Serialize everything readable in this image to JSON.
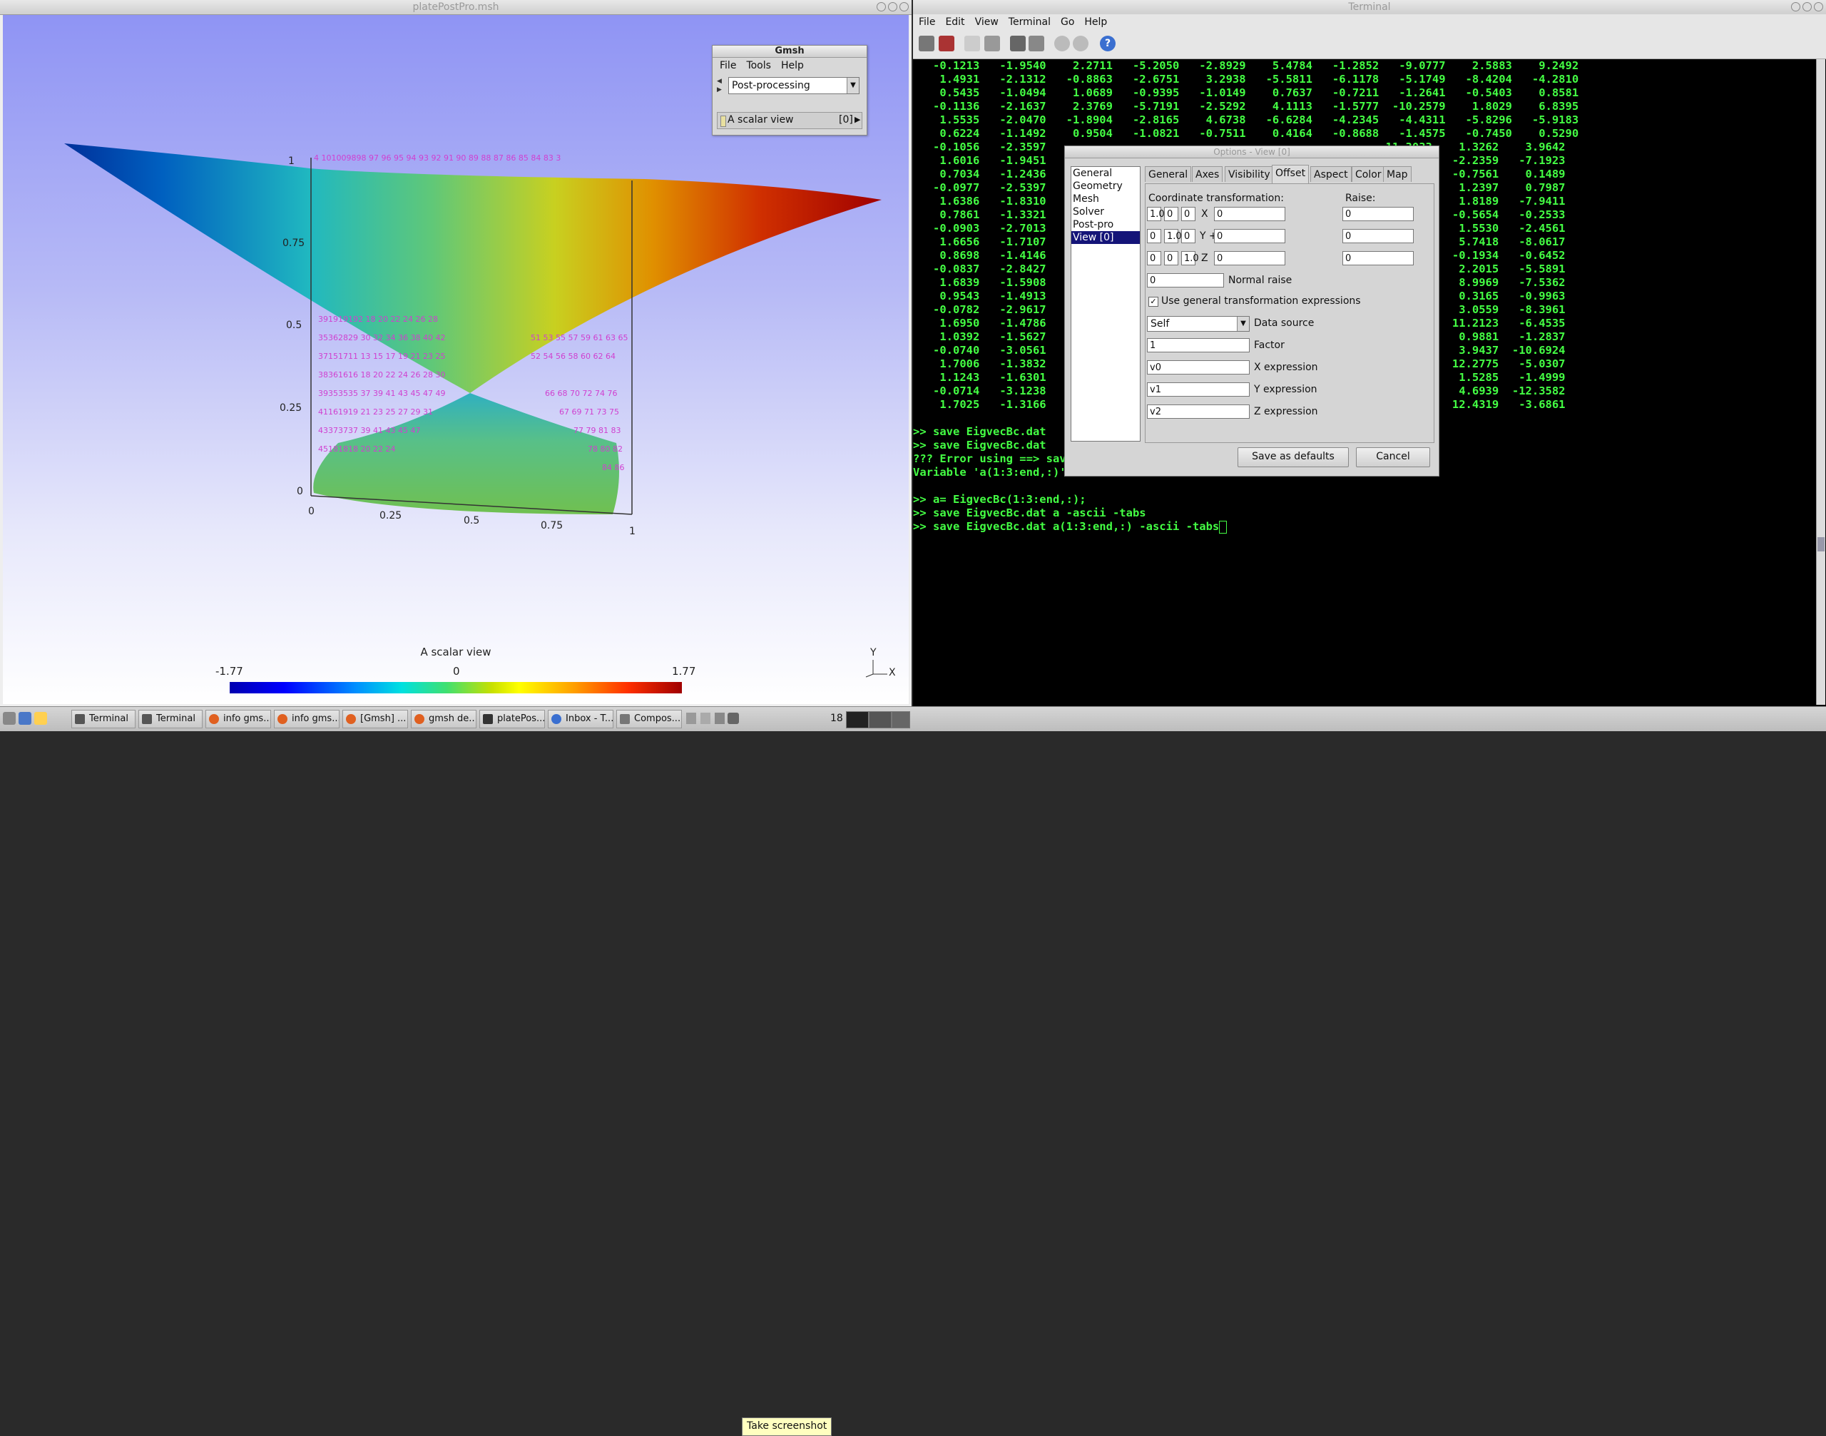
{
  "gmsh": {
    "window_title": "platePostPro.msh",
    "small_title": "Gmsh",
    "menu": [
      "File",
      "Tools",
      "Help"
    ],
    "module": "Post-processing",
    "view_label": "A scalar view",
    "view_index": "[0]",
    "colorbar": {
      "title": "A scalar view",
      "min": "-1.77",
      "mid": "0",
      "max": "1.77"
    },
    "axis_y_ticks": [
      "1",
      "0.75",
      "0.5",
      "0.25",
      "0"
    ],
    "axis_x_ticks": [
      "0",
      "0.25",
      "0.5",
      "0.75",
      "1"
    ],
    "axes_triad": {
      "y": "Y",
      "x": "X"
    }
  },
  "terminal": {
    "window_title": "Terminal",
    "menu": [
      "File",
      "Edit",
      "View",
      "Terminal",
      "Go",
      "Help"
    ],
    "lines": [
      "   -0.1213   -1.9540    2.2711   -5.2050   -2.8929    5.4784   -1.2852   -9.0777    2.5883    9.2492",
      "    1.4931   -2.1312   -0.8863   -2.6751    3.2938   -5.5811   -6.1178   -5.1749   -8.4204   -4.2810",
      "    0.5435   -1.0494    1.0689   -0.9395   -1.0149    0.7637   -0.7211   -1.2641   -0.5403    0.8581",
      "   -0.1136   -2.1637    2.3769   -5.7191   -2.5292    4.1113   -1.5777  -10.2579    1.8029    6.8395",
      "    1.5535   -2.0470   -1.8904   -2.8165    4.6738   -6.6284   -4.2345   -4.4311   -5.8296   -5.9183",
      "    0.6224   -1.1492    0.9504   -1.0821   -0.7511    0.4164   -0.8688   -1.4575   -0.7450    0.5290",
      "   -0.1056   -2.3597                                                   11.3033    1.3262    3.9642",
      "    1.6016   -1.9451                                                   -3.2497   -2.2359   -7.1923",
      "    0.7034   -1.2436                                                   -1.5836   -0.7561    0.1489",
      "   -0.0977   -2.5397                                                   12.1717    1.2397    0.7987",
      "    1.6386   -1.8310                                                    1.7663    1.8189   -7.9411",
      "    0.7861   -1.3321                                                   -1.6316   -0.5654   -0.2533",
      "   -0.0903   -2.7013                                                   12.8420    1.5530   -2.4561",
      "    1.6656   -1.7107                                                   -0.1509    5.7418   -8.0617",
      "    0.8698   -1.4146                                                   -1.5993   -0.1934   -0.6452",
      "   -0.0837   -2.8427                                                   13.3175    2.2015   -5.5891",
      "    1.6839   -1.5908                                                    1.4187    8.9969   -7.5362",
      "    0.9543   -1.4913                                                   -1.4930    0.3165   -0.9963",
      "   -0.0782   -2.9617                                                   13.6250    3.0559   -8.3961",
      "    1.6950   -1.4786                                                    2.7842   11.2123   -6.4535",
      "    1.0392   -1.5627                                                   -1.3261    0.9881   -1.2837",
      "   -0.0740   -3.0561                                                   13.8087    3.9437  -10.6924",
      "    1.7006   -1.3832                                                    3.8315   12.2775   -5.0307",
      "    1.1243   -1.6301                                                   -1.1164    1.5285   -1.4999",
      "   -0.0714   -3.1238                                                   13.9301    4.6939  -12.3582",
      "    1.7025   -1.3166                                                    4.4909   12.4319   -3.6861",
      "",
      ">> save EigvecBc.dat",
      ">> save EigvecBc.dat",
      "??? Error using ==> save",
      "Variable 'a(1:3:end,:)' not found.",
      "",
      ">> a= EigvecBc(1:3:end,:);",
      ">> save EigvecBc.dat a -ascii -tabs",
      ">> save EigvecBc.dat a(1:3:end,:) -ascii -tabs"
    ]
  },
  "options": {
    "title": "Options - View [0]",
    "categories": [
      "General",
      "Geometry",
      "Mesh",
      "Solver",
      "Post-pro",
      "View [0]"
    ],
    "tabs": [
      "General",
      "Axes",
      "Visibility",
      "Offset",
      "Aspect",
      "Color",
      "Map"
    ],
    "coord_label": "Coordinate transformation:",
    "raise_label": "Raise:",
    "matrix": [
      [
        "1.0",
        "0",
        "0"
      ],
      [
        "0",
        "1.0",
        "0"
      ],
      [
        "0",
        "0",
        "1.0"
      ]
    ],
    "axis_labels": [
      "X",
      "Y +",
      "Z"
    ],
    "offsets": [
      "0",
      "0",
      "0"
    ],
    "raises": [
      "0",
      "0",
      "0"
    ],
    "normal_raise_value": "0",
    "normal_raise_label": "Normal raise",
    "use_general_label": "Use general transformation expressions",
    "data_source_value": "Self",
    "data_source_label": "Data source",
    "factor_value": "1",
    "factor_label": "Factor",
    "x_expr_value": "v0",
    "x_expr_label": "X expression",
    "y_expr_value": "v1",
    "y_expr_label": "Y expression",
    "z_expr_value": "v2",
    "z_expr_label": "Z expression",
    "save_defaults": "Save as defaults",
    "cancel": "Cancel"
  },
  "taskbar": {
    "tasks": [
      "Terminal",
      "Terminal",
      "info gms...",
      "info gms...",
      "[Gmsh] ...",
      "gmsh de...",
      "platePos...",
      "Inbox - T...",
      "Compos..."
    ],
    "tooltip": "Take screenshot",
    "indicator": "18"
  }
}
